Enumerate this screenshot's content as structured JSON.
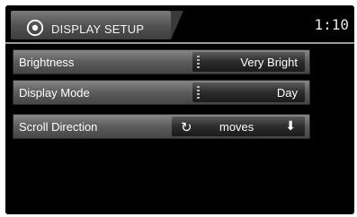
{
  "header": {
    "title": "DISPLAY SETUP",
    "clock": "1:10",
    "icon": "gear-icon"
  },
  "settings": [
    {
      "label": "Brightness",
      "value": "Very Bright"
    },
    {
      "label": "Display Mode",
      "value": "Day"
    },
    {
      "label": "Scroll Direction",
      "value": "moves"
    }
  ],
  "icons": {
    "scroll_left": "rotate-icon",
    "scroll_right": "down-arrow-icon"
  },
  "colors": {
    "background": "#000000",
    "row": "#5c5c5c",
    "text": "#ffffff"
  }
}
